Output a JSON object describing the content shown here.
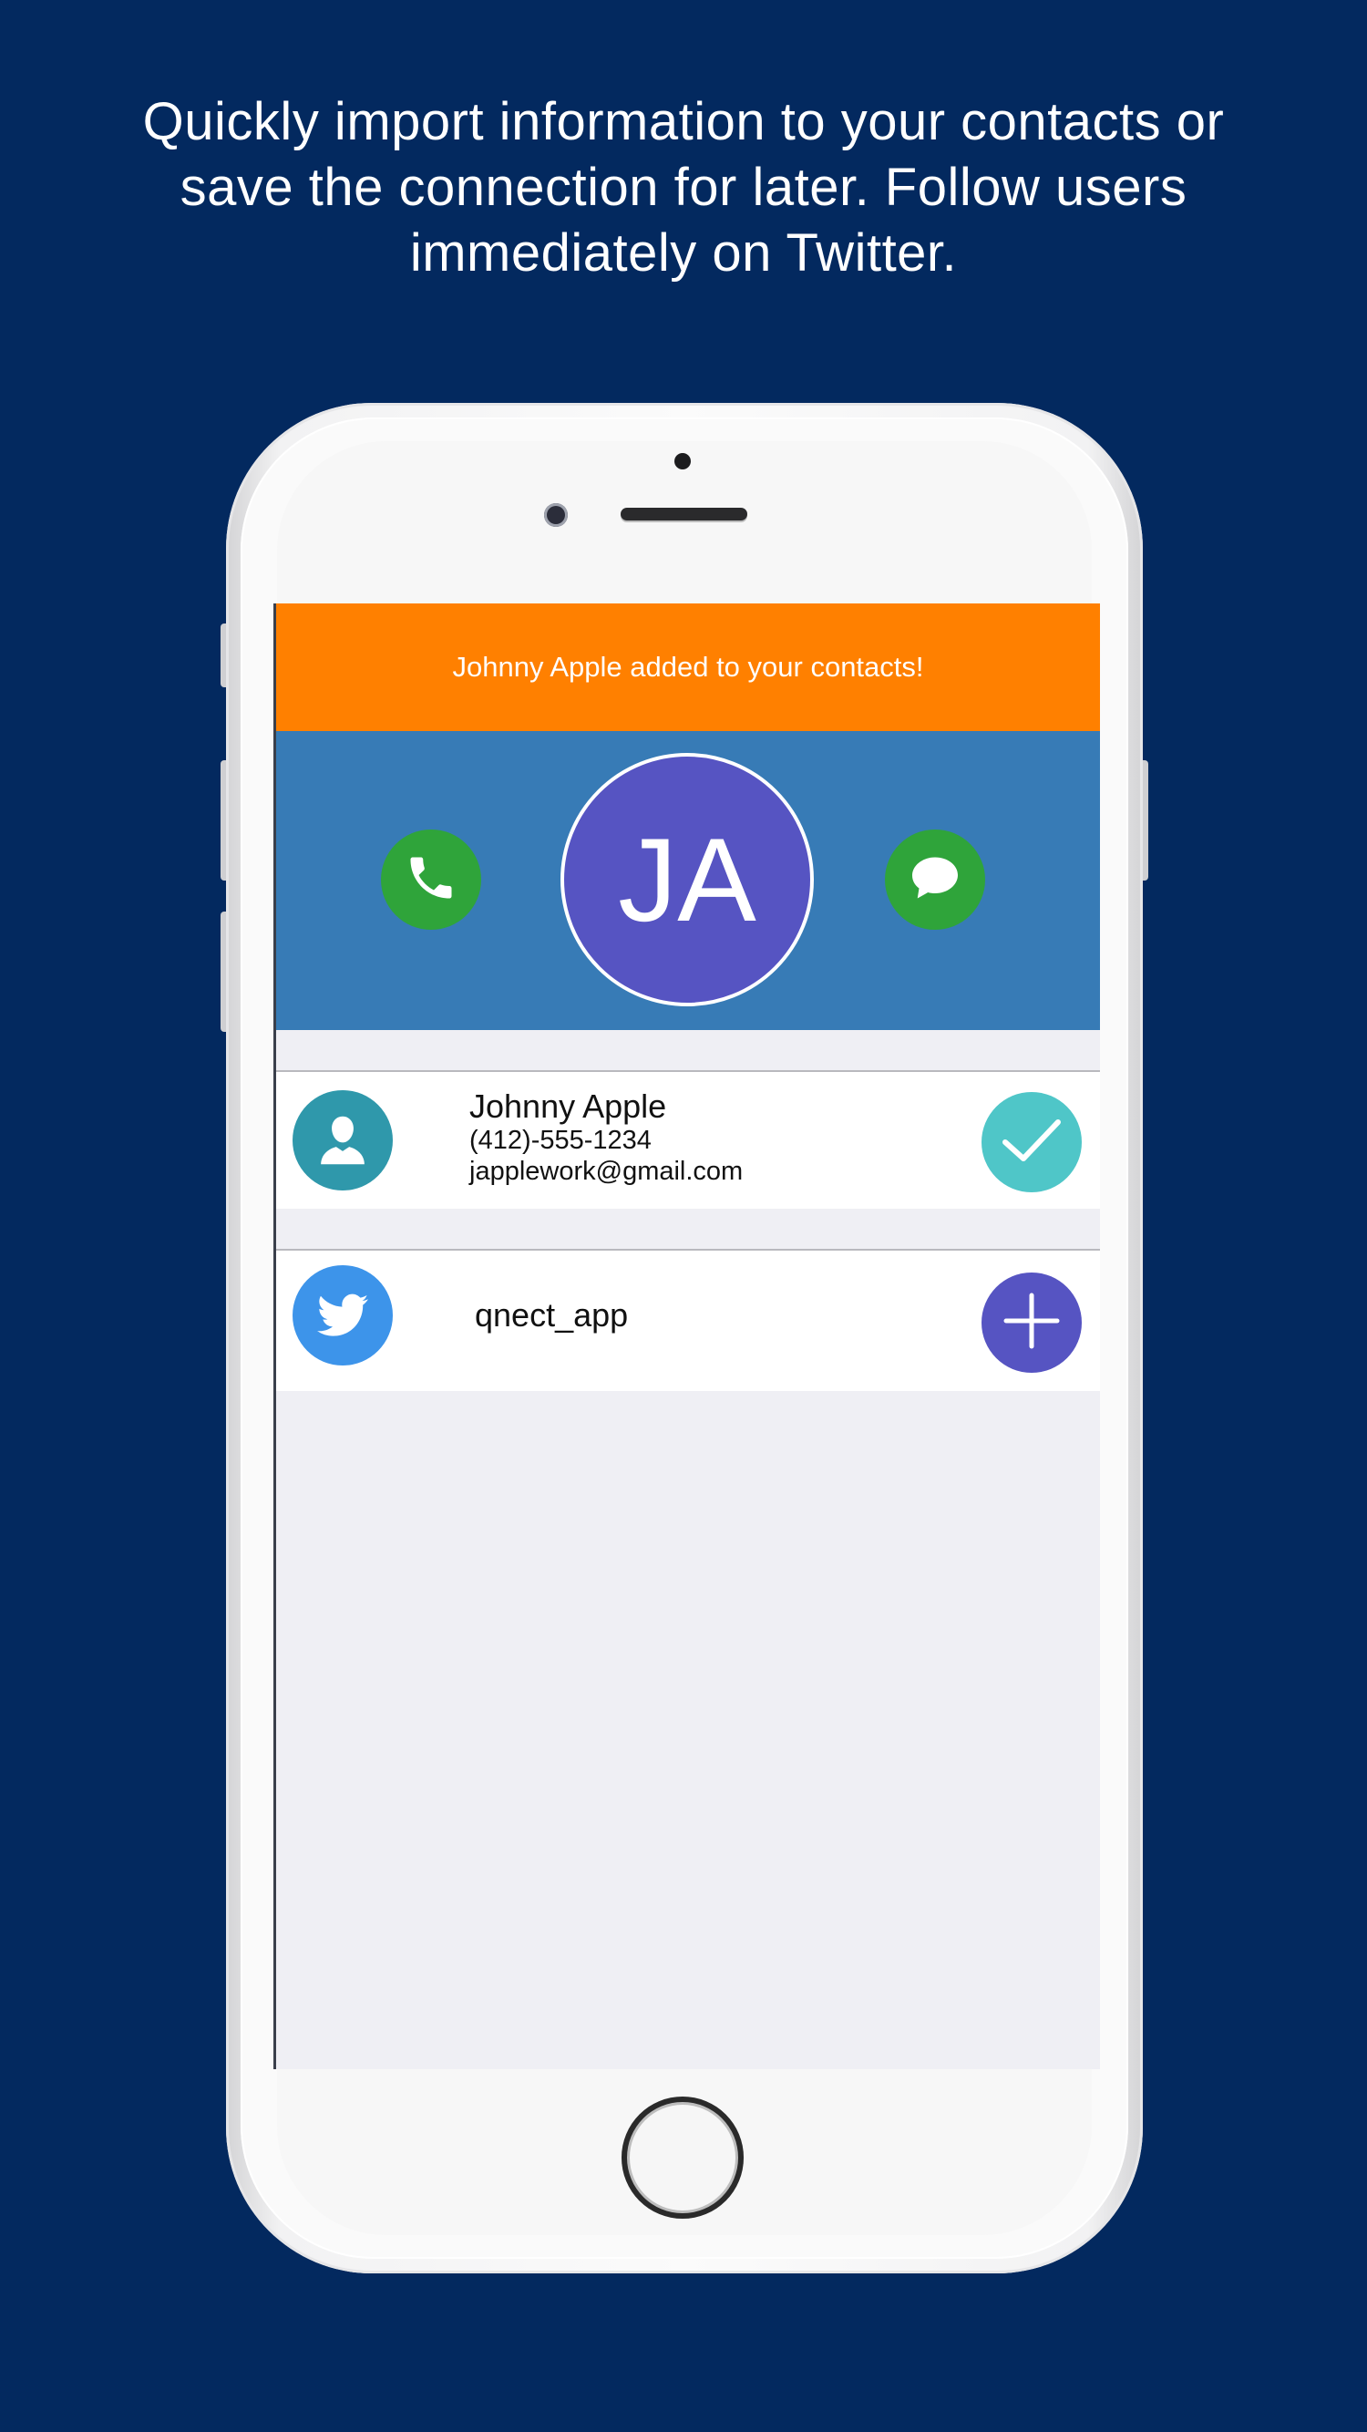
{
  "headline": "Quickly import information to your contacts or save the connection for later. Follow users immediately on Twitter.",
  "banner": {
    "text": "Johnny Apple added to your contacts!",
    "color": "#ff8000"
  },
  "profile": {
    "initials": "JA",
    "avatar_color": "#5654c2",
    "header_color": "#377bb6"
  },
  "contact": {
    "name": "Johnny Apple",
    "phone": "(412)-555-1234",
    "email": "japplework@gmail.com",
    "status_icon": "check-icon",
    "status_color": "#4fc6c8"
  },
  "twitter": {
    "handle": "qnect_app",
    "action_icon": "plus-icon",
    "action_color": "#5654c2"
  }
}
